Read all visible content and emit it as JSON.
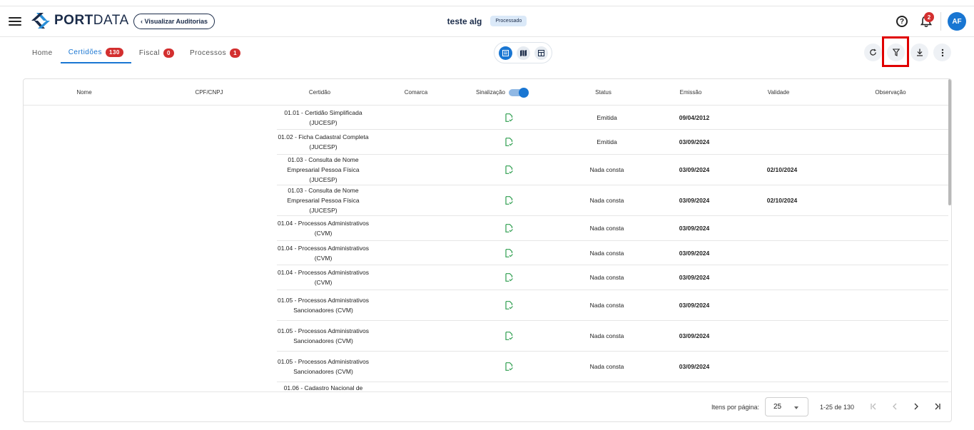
{
  "header": {
    "logo_bold": "PORT",
    "logo_light": "DATA",
    "back_button": "‹ Visualizar Auditorias",
    "title": "teste alg",
    "status_badge": "Processado",
    "notification_count": "2",
    "avatar": "AF"
  },
  "tabs": [
    {
      "label": "Home",
      "count": ""
    },
    {
      "label": "Certidões",
      "count": "130"
    },
    {
      "label": "Fiscal",
      "count": "0"
    },
    {
      "label": "Processos",
      "count": "1"
    }
  ],
  "table": {
    "columns": {
      "nome": "Nome",
      "cpf": "CPF/CNPJ",
      "certidao": "Certidão",
      "comarca": "Comarca",
      "sinalizacao": "Sinalização",
      "status": "Status",
      "emissao": "Emissão",
      "validade": "Validade",
      "observacao": "Observação"
    },
    "rows": [
      {
        "certidao": "01.01 - Certidão Simplificada (JUCESP)",
        "status": "Emitida",
        "emissao": "09/04/2012",
        "validade": ""
      },
      {
        "certidao": "01.02 - Ficha Cadastral Completa (JUCESP)",
        "status": "Emitida",
        "emissao": "03/09/2024",
        "validade": ""
      },
      {
        "certidao": "01.03 - Consulta de Nome Empresarial Pessoa Física (JUCESP)",
        "status": "Nada consta",
        "emissao": "03/09/2024",
        "validade": "02/10/2024"
      },
      {
        "certidao": "01.03 - Consulta de Nome Empresarial Pessoa Física (JUCESP)",
        "status": "Nada consta",
        "emissao": "03/09/2024",
        "validade": "02/10/2024"
      },
      {
        "certidao": "01.04 - Processos Administrativos (CVM)",
        "status": "Nada consta",
        "emissao": "03/09/2024",
        "validade": ""
      },
      {
        "certidao": "01.04 - Processos Administrativos (CVM)",
        "status": "Nada consta",
        "emissao": "03/09/2024",
        "validade": ""
      },
      {
        "certidao": "01.04 - Processos Administrativos (CVM)",
        "status": "Nada consta",
        "emissao": "03/09/2024",
        "validade": ""
      },
      {
        "certidao": "01.05 - Processos Administrativos Sancionadores (CVM)",
        "status": "Nada consta",
        "emissao": "03/09/2024",
        "validade": ""
      },
      {
        "certidao": "01.05 - Processos Administrativos Sancionadores (CVM)",
        "status": "Nada consta",
        "emissao": "03/09/2024",
        "validade": ""
      },
      {
        "certidao": "01.05 - Processos Administrativos Sancionadores (CVM)",
        "status": "Nada consta",
        "emissao": "03/09/2024",
        "validade": ""
      },
      {
        "certidao": "01.06 - Cadastro Nacional de",
        "status": "",
        "emissao": "",
        "validade": ""
      }
    ]
  },
  "pagination": {
    "items_per_page_label": "Itens por página:",
    "items_per_page": "25",
    "range": "1-25 de 130"
  },
  "colors": {
    "accent": "#1976d2",
    "badge_red": "#d32f2f",
    "highlight": "#e00000",
    "doc_icon": "#2e9e4f"
  }
}
